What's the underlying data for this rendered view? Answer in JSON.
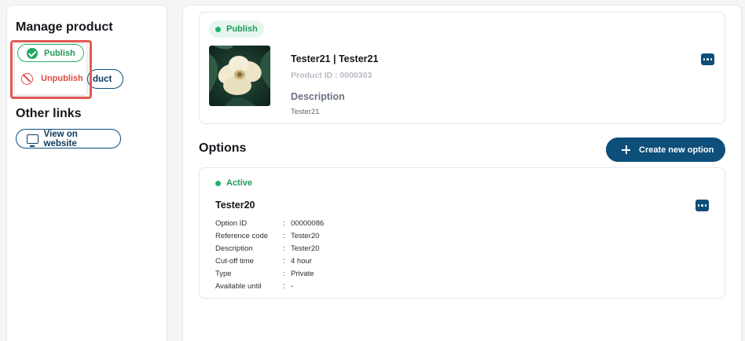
{
  "sidebar": {
    "manage_title": "Manage product",
    "other_title": "Other links",
    "behind_button_label": "duct",
    "view_website_label": "View on website",
    "dropdown": {
      "publish_label": "Publish",
      "unpublish_label": "Unpublish"
    }
  },
  "product": {
    "status": "Publish",
    "name": "Tester21 | Tester21",
    "product_id": "Product ID : 0000303",
    "description_label": "Description",
    "description": "Tester21"
  },
  "options": {
    "title": "Options",
    "create_label": "Create new option",
    "items": [
      {
        "status": "Active",
        "name": "Tester20",
        "fields": [
          {
            "key": "Option ID",
            "value": "00000086"
          },
          {
            "key": "Reference code",
            "value": "Tester20"
          },
          {
            "key": "Description",
            "value": "Tester20"
          },
          {
            "key": "Cut-off time",
            "value": "4 hour"
          },
          {
            "key": "Type",
            "value": "Private"
          },
          {
            "key": "Available until",
            "value": "-"
          }
        ]
      }
    ]
  },
  "colors": {
    "primary": "#0d4e7a",
    "success": "#1fb468",
    "danger": "#e04b44",
    "highlight": "#e05a55"
  },
  "icons": [
    "check-circle-icon",
    "ban-icon",
    "monitor-icon",
    "more-dots-icon",
    "plus-icon"
  ]
}
